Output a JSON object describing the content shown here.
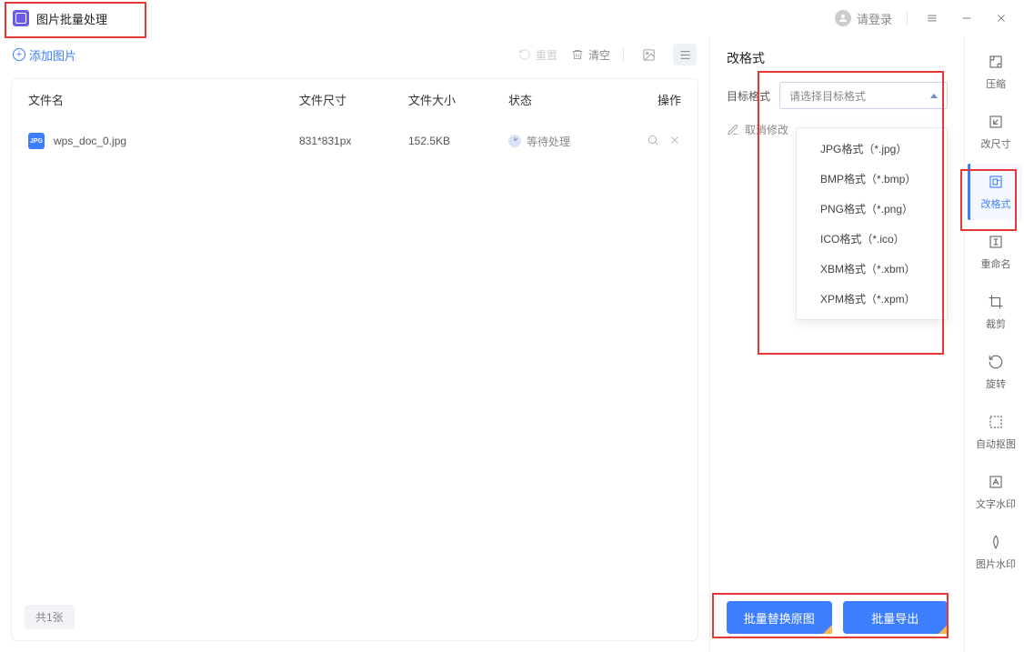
{
  "titlebar": {
    "app_name": "图片批量处理",
    "login_text": "请登录"
  },
  "toolbar": {
    "add_label": "添加图片",
    "reset_label": "重置",
    "clear_label": "清空"
  },
  "table": {
    "headers": {
      "name": "文件名",
      "dim": "文件尺寸",
      "size": "文件大小",
      "status": "状态",
      "op": "操作"
    },
    "rows": [
      {
        "name": "wps_doc_0.jpg",
        "dim": "831*831px",
        "size": "152.5KB",
        "status": "等待处理"
      }
    ],
    "count_text": "共1张"
  },
  "panel": {
    "title": "改格式",
    "target_label": "目标格式",
    "select_placeholder": "请选择目标格式",
    "cancel_label": "取消修改",
    "options": [
      "JPG格式（*.jpg）",
      "BMP格式（*.bmp）",
      "PNG格式（*.png）",
      "ICO格式（*.ico）",
      "XBM格式（*.xbm）",
      "XPM格式（*.xpm）"
    ],
    "btn_replace": "批量替换原图",
    "btn_export": "批量导出"
  },
  "rail": {
    "items": [
      {
        "id": "compress",
        "label": "压缩"
      },
      {
        "id": "resize",
        "label": "改尺寸"
      },
      {
        "id": "reformat",
        "label": "改格式"
      },
      {
        "id": "rename",
        "label": "重命名"
      },
      {
        "id": "crop",
        "label": "裁剪"
      },
      {
        "id": "rotate",
        "label": "旋转"
      },
      {
        "id": "autocutout",
        "label": "自动抠图"
      },
      {
        "id": "textwm",
        "label": "文字水印"
      },
      {
        "id": "imgwm",
        "label": "图片水印"
      }
    ],
    "active": "reformat"
  }
}
